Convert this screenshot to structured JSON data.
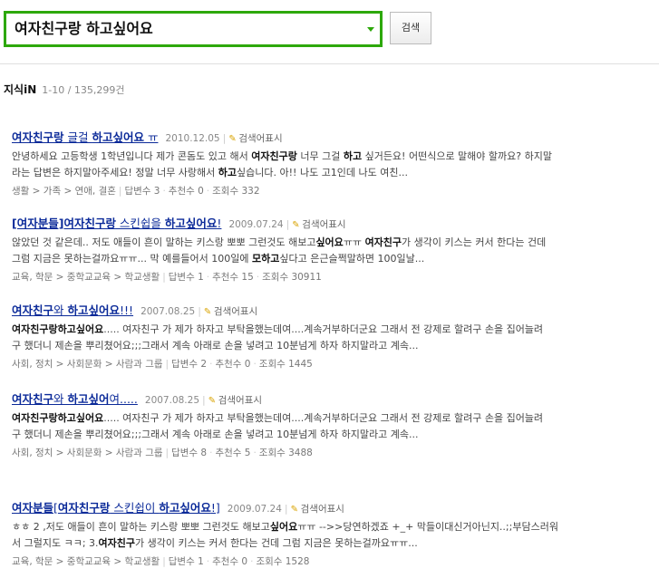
{
  "search": {
    "query": "여자친구랑 하고싶어요",
    "button_label": "검색"
  },
  "section": {
    "title": "지식iN",
    "count": "1-10 / 135,299건"
  },
  "results": [
    {
      "title": [
        {
          "t": "여자친구랑",
          "b": true
        },
        {
          "t": " 글걸 ",
          "b": false
        },
        {
          "t": "하고싶어요",
          "b": true
        },
        {
          "t": " ㅠ",
          "b": false
        }
      ],
      "date": "2010.12.05",
      "action": "검색어표시",
      "lines": [
        [
          {
            "t": "안녕하세요 고등학생 1학년입니다 제가 콘돔도 있고 해서 ",
            "b": false
          },
          {
            "t": "여자친구랑",
            "b": true
          },
          {
            "t": " 너무 그걸 ",
            "b": false
          },
          {
            "t": "하고",
            "b": true
          },
          {
            "t": " 싶거든요! 어떤식으로 말해야 할까요? 하지말",
            "b": false
          }
        ],
        [
          {
            "t": "라는 답변은 하지말아주세요! 정말 너무 사랑해서 ",
            "b": false
          },
          {
            "t": "하고",
            "b": true
          },
          {
            "t": "싶습니다. 아!! 나도 고1인데 나도 여친...",
            "b": false
          }
        ]
      ],
      "meta": {
        "category": "생활 > 가족 > 연애, 결혼",
        "answers": "답변수 3",
        "recommend": "추천수 0",
        "views": "조회수 332"
      }
    },
    {
      "title": [
        {
          "t": "[여자분들]",
          "b": true
        },
        {
          "t": "여자친구랑",
          "b": true
        },
        {
          "t": " 스킨쉽을 ",
          "b": false
        },
        {
          "t": "하고싶어요",
          "b": true
        },
        {
          "t": "!",
          "b": false
        }
      ],
      "date": "2009.07.24",
      "action": "검색어표시",
      "lines": [
        [
          {
            "t": "않았던 것 같은데.. 저도 애들이 흔이 말하는 키스랑 뽀뽀 그런것도 해보고",
            "b": false
          },
          {
            "t": "싶어요",
            "b": true
          },
          {
            "t": "ㅠㅠ ",
            "b": false
          },
          {
            "t": "여자친구",
            "b": true
          },
          {
            "t": "가 생각이 키스는 커서 한다는 건데",
            "b": false
          }
        ],
        [
          {
            "t": "그럼 지금은 못하는걸까요ㅠㅠ... 막 예를들어서 100일에 ",
            "b": false
          },
          {
            "t": "모하고",
            "b": true
          },
          {
            "t": "싶다고 은근슬쩍말하면 100일날...",
            "b": false
          }
        ]
      ],
      "meta": {
        "category": "교육, 학문 > 중학교교육 > 학교생활",
        "answers": "답변수 1",
        "recommend": "추천수 15",
        "views": "조회수 30911"
      }
    },
    {
      "title": [
        {
          "t": "여자친구",
          "b": true
        },
        {
          "t": "와 ",
          "b": false
        },
        {
          "t": "하고싶어요",
          "b": true
        },
        {
          "t": "!!!",
          "b": false
        }
      ],
      "date": "2007.08.25",
      "action": "검색어표시",
      "lines": [
        [
          {
            "t": "여자친구랑하고싶어요",
            "b": true
          },
          {
            "t": "..... 여자친구 가 제가 하자고 부탁을했는데여....계속거부하더군요 그래서 전 강제로 할려구 손을 집어늘려",
            "b": false
          }
        ],
        [
          {
            "t": "구 했더니 제손을 뿌리쳤어요;;;그래서 계속 아래로 손을 넣려고 10분넘게 하자 하지말라고 계속...",
            "b": false
          }
        ]
      ],
      "meta": {
        "category": "사회, 정치 > 사회문화 > 사람과 그룹",
        "answers": "답변수 2",
        "recommend": "추천수 0",
        "views": "조회수 1445"
      }
    },
    {
      "title": [
        {
          "t": "여자친구",
          "b": true
        },
        {
          "t": "와 ",
          "b": false
        },
        {
          "t": "하고싶어",
          "b": true
        },
        {
          "t": "여.....",
          "b": false
        }
      ],
      "date": "2007.08.25",
      "action": "검색어표시",
      "lines": [
        [
          {
            "t": "여자친구랑하고싶어요",
            "b": true
          },
          {
            "t": "..... 여자친구 가 제가 하자고 부탁을했는데여....계속거부하더군요 그래서 전 강제로 할려구 손을 집어늘려",
            "b": false
          }
        ],
        [
          {
            "t": "구 했더니 제손을 뿌리쳤어요;;;그래서 계속 아래로 손을 넣려고 10분넘게 하자 하지말라고 계속...",
            "b": false
          }
        ]
      ],
      "meta": {
        "category": "사회, 정치 > 사회문화 > 사람과 그룹",
        "answers": "답변수 8",
        "recommend": "추천수 5",
        "views": "조회수 3488"
      }
    },
    {
      "title": [
        {
          "t": "여자분들",
          "b": true
        },
        {
          "t": "[",
          "b": false
        },
        {
          "t": "여자친구랑",
          "b": true
        },
        {
          "t": " 스킨쉽이 ",
          "b": false
        },
        {
          "t": "하고싶어요",
          "b": true
        },
        {
          "t": "!]",
          "b": false
        }
      ],
      "date": "2009.07.24",
      "action": "검색어표시",
      "lines": [
        [
          {
            "t": "ㅎㅎ 2 ,저도 애들이 흔이 말하는 키스랑 뽀뽀 그런것도 해보고",
            "b": false
          },
          {
            "t": "싶어요",
            "b": true
          },
          {
            "t": "ㅠㅠ -->>당연하겠죠 +_+ 막들이대신거아닌지..;;부담스러워",
            "b": false
          }
        ],
        [
          {
            "t": "서 그럴지도 ㅋㅋ; 3.",
            "b": false
          },
          {
            "t": "여자친구",
            "b": true
          },
          {
            "t": "가 생각이 키스는 커서 한다는 건데 그럼 지금은 못하는걸까요ㅠㅠ...",
            "b": false
          }
        ]
      ],
      "meta": {
        "category": "교육, 학문 > 중학교교육 > 학교생활",
        "answers": "답변수 1",
        "recommend": "추천수 0",
        "views": "조회수 1528"
      }
    }
  ]
}
